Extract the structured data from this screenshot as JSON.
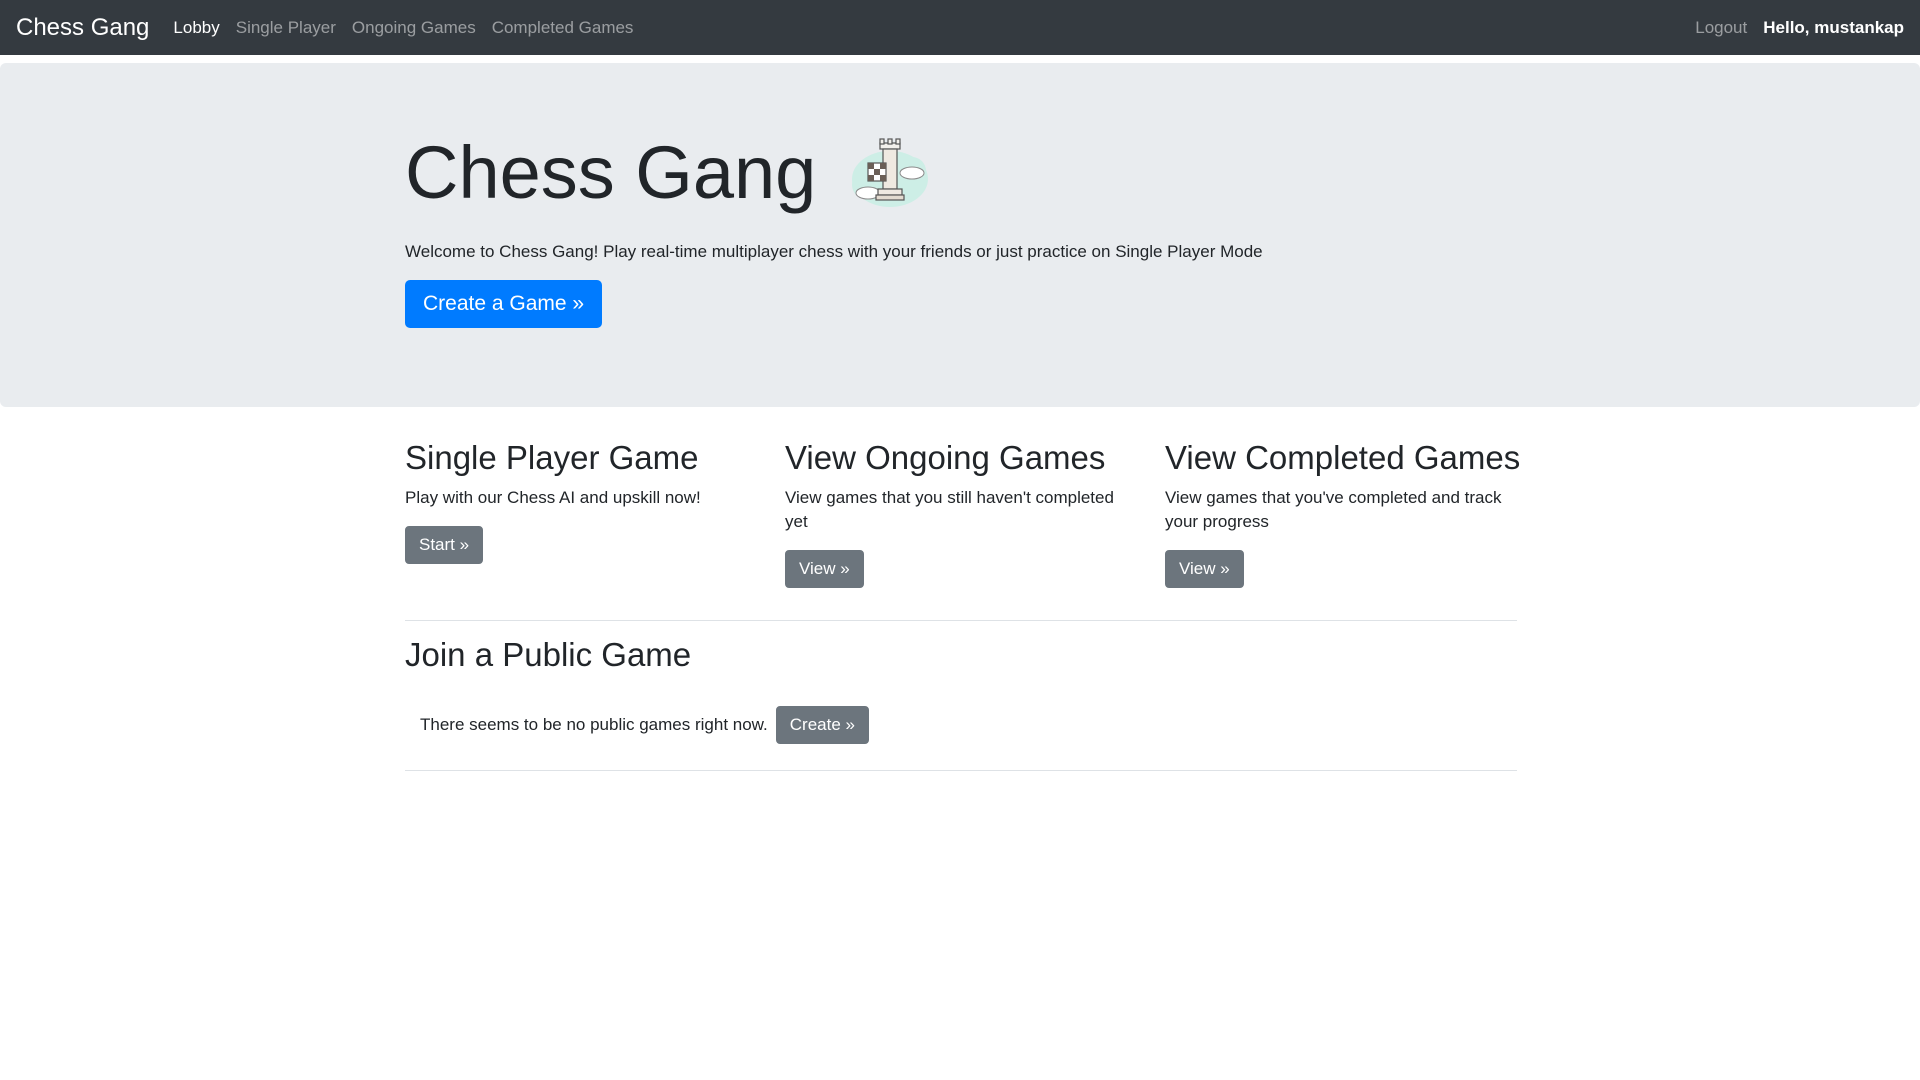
{
  "navbar": {
    "brand": "Chess Gang",
    "links": [
      {
        "label": "Lobby",
        "active": true
      },
      {
        "label": "Single Player",
        "active": false
      },
      {
        "label": "Ongoing Games",
        "active": false
      },
      {
        "label": "Completed Games",
        "active": false
      }
    ],
    "logout_label": "Logout",
    "greeting": "Hello, mustankap"
  },
  "jumbotron": {
    "title": "Chess Gang",
    "logo_icon": "chess-rook-icon",
    "lead": "Welcome to Chess Gang! Play real-time multiplayer chess with your friends or just practice on Single Player Mode",
    "create_button": "Create a Game »"
  },
  "features": [
    {
      "title": "Single Player Game",
      "description": "Play with our Chess AI and upskill now!",
      "button": "Start »"
    },
    {
      "title": "View Ongoing Games",
      "description": "View games that you still haven't completed yet",
      "button": "View »"
    },
    {
      "title": "View Completed Games",
      "description": "View games that you've completed and track your progress",
      "button": "View »"
    }
  ],
  "public_games": {
    "title": "Join a Public Game",
    "empty_message": "There seems to be no public games right now.",
    "create_button": "Create »"
  },
  "colors": {
    "navbar_bg": "#343a40",
    "jumbotron_bg": "#e9ecef",
    "primary": "#007bff",
    "secondary": "#6c757d"
  }
}
